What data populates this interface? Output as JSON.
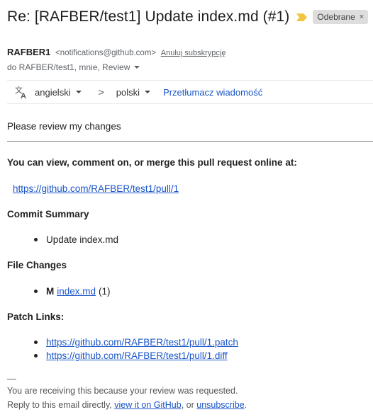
{
  "subject": "Re: [RAFBER/test1] Update index.md (#1)",
  "label_chip": {
    "text": "Odebrane",
    "close": "×"
  },
  "colors": {
    "important": "#f4c542",
    "link": "#1a55c9",
    "chip_bg": "#dddddd"
  },
  "sender": {
    "name": "RAFBER1",
    "email": "<notifications@github.com>",
    "unsubscribe": "Anuluj subskrypcję",
    "to": "do RAFBER/test1, mnie, Review"
  },
  "translate": {
    "icon": "translate-icon",
    "from": "angielski",
    "arrow": ">",
    "to": "polski",
    "action": "Przetłumacz wiadomość"
  },
  "body": {
    "intro": "Please review my changes",
    "view_heading": "You can view, comment on, or merge this pull request online at:",
    "pr_url": "https://github.com/RAFBER/test1/pull/1",
    "commit_heading": "Commit Summary",
    "commits": [
      "Update index.md"
    ],
    "files_heading": "File Changes",
    "file": {
      "mode": "M",
      "name": "index.md",
      "count": "(1)"
    },
    "patch_heading": "Patch Links:",
    "patch_links": [
      "https://github.com/RAFBER/test1/pull/1.patch",
      "https://github.com/RAFBER/test1/pull/1.diff"
    ]
  },
  "footer": {
    "dash": "—",
    "line1": "You are receiving this because your review was requested.",
    "line2_prefix": "Reply to this email directly, ",
    "view_on_github": "view it on GitHub",
    "or": ", or ",
    "unsubscribe": "unsubscribe",
    "period": "."
  }
}
